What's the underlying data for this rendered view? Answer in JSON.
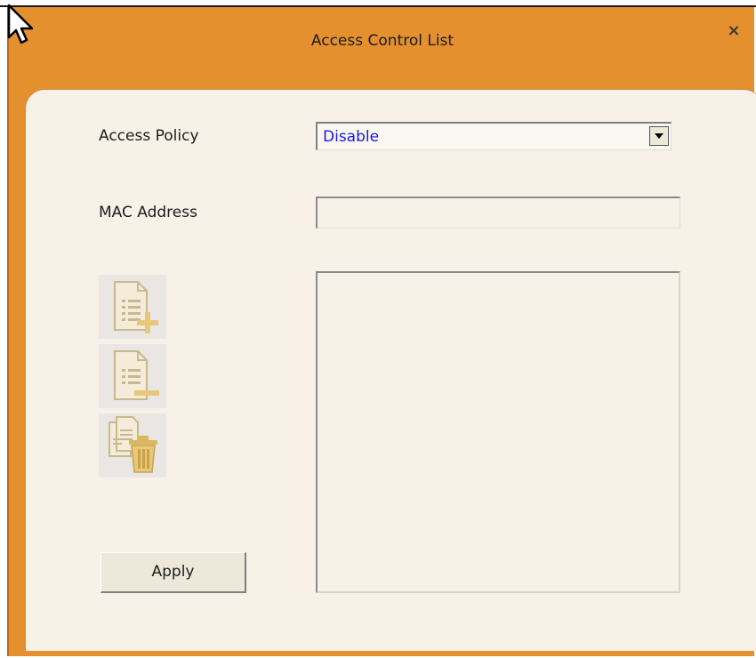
{
  "dialog": {
    "title": "Access Control List",
    "close_label": "×"
  },
  "form": {
    "access_policy_label": "Access Policy",
    "access_policy_value": "Disable",
    "mac_address_label": "MAC Address",
    "mac_address_value": "",
    "apply_label": "Apply"
  },
  "toolbar": {
    "icons": [
      "add-entry-icon",
      "remove-entry-icon",
      "delete-all-icon"
    ]
  },
  "mac_list": {
    "items": []
  },
  "colors": {
    "title_bar": "#e4902e",
    "panel_bg": "#f8f1e7",
    "select_text": "#1a1adc",
    "icon_tint": "#e8c878"
  }
}
